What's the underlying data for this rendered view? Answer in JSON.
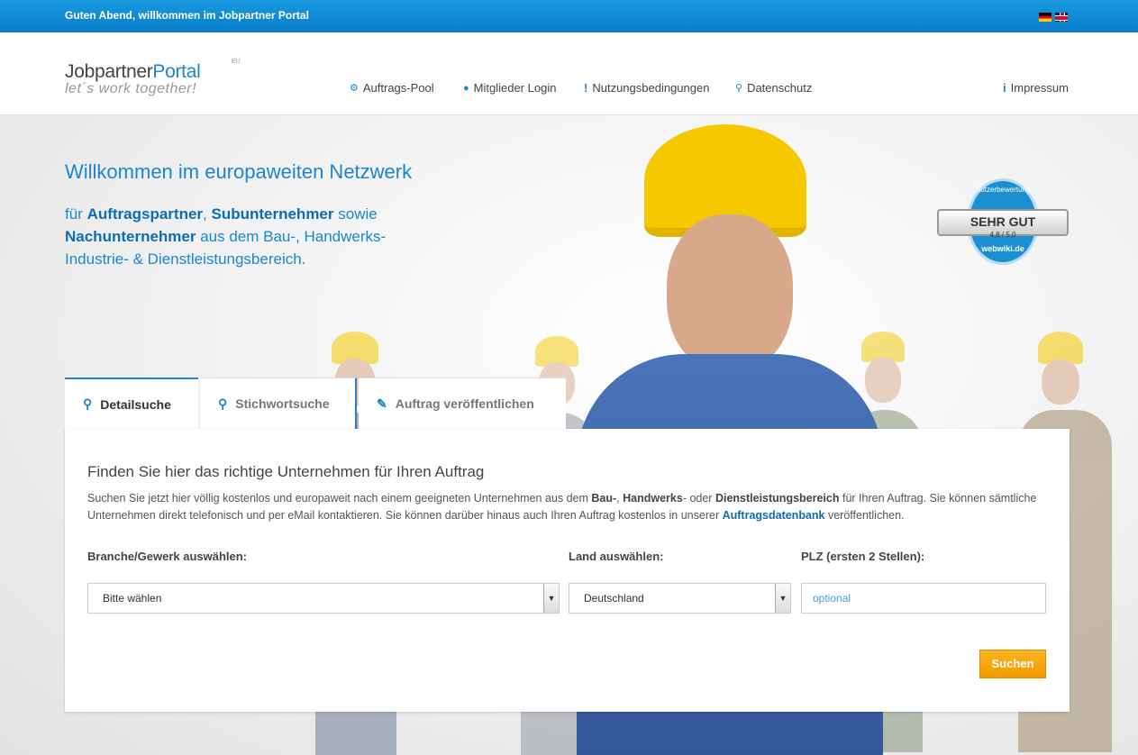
{
  "topbar": {
    "greeting": "Guten Abend, willkommen im Jobpartner Portal"
  },
  "logo": {
    "name_part1": "Jobpartner",
    "name_part2": "Portal",
    "superscript": "EU",
    "tagline": "let´s work together!"
  },
  "nav": [
    {
      "label": "Auftrags-Pool",
      "icon": "gears-icon"
    },
    {
      "label": "Mitglieder Login",
      "icon": "user-icon"
    },
    {
      "label": "Nutzungsbedingungen",
      "icon": "exclamation-icon"
    },
    {
      "label": "Datenschutz",
      "icon": "key-icon"
    },
    {
      "label": "Impressum",
      "icon": "info-icon"
    }
  ],
  "hero": {
    "title": "Willkommen im europaweiten Netzwerk",
    "sub_1": "für ",
    "sub_b1": "Auftragspartner",
    "sub_2": ", ",
    "sub_b2": "Subunternehmer",
    "sub_3": " sowie ",
    "sub_b3": "Nachunternehmer",
    "sub_4": " aus dem Bau-, Handwerks- Industrie- & Dienstleistungsbereich."
  },
  "badge": {
    "top": "Nutzerbewertung",
    "main": "SEHR GUT",
    "rating": "4,8 / 5,0",
    "bottom": "webwiki.de"
  },
  "tabs": [
    {
      "label": "Detailsuche",
      "icon": "search-plus-icon",
      "active": true
    },
    {
      "label": "Stichwortsuche",
      "icon": "search-icon",
      "active": false
    },
    {
      "label": "Auftrag veröffentlichen",
      "icon": "edit-icon",
      "active": false
    }
  ],
  "panel": {
    "heading": "Finden Sie hier das richtige Unternehmen für Ihren Auftrag",
    "desc_1": "Suchen Sie jetzt hier völlig kostenlos und europaweit nach einem geeigneten Unternehmen aus dem ",
    "desc_b1": "Bau-",
    "desc_2": ", ",
    "desc_b2": "Handwerks",
    "desc_3": "- oder ",
    "desc_b3": "Dienstleistungsbereich",
    "desc_4": " für Ihren Auftrag. Sie können sämtliche Unternehmen direkt telefonisch und per eMail kontaktieren. Sie können darüber hinaus auch Ihren Auftrag kostenlos in unserer ",
    "desc_link": "Auftragsdatenbank",
    "desc_5": " veröffentlichen.",
    "branche_label": "Branche/Gewerk auswählen:",
    "branche_value": "Bitte wählen",
    "land_label": "Land auswählen:",
    "land_value": "Deutschland",
    "plz_label": "PLZ (ersten 2 Stellen):",
    "plz_placeholder": "optional",
    "submit_label": "Suchen"
  },
  "colors": {
    "brand_blue": "#1a86d0",
    "accent_orange": "#f5a20a"
  }
}
